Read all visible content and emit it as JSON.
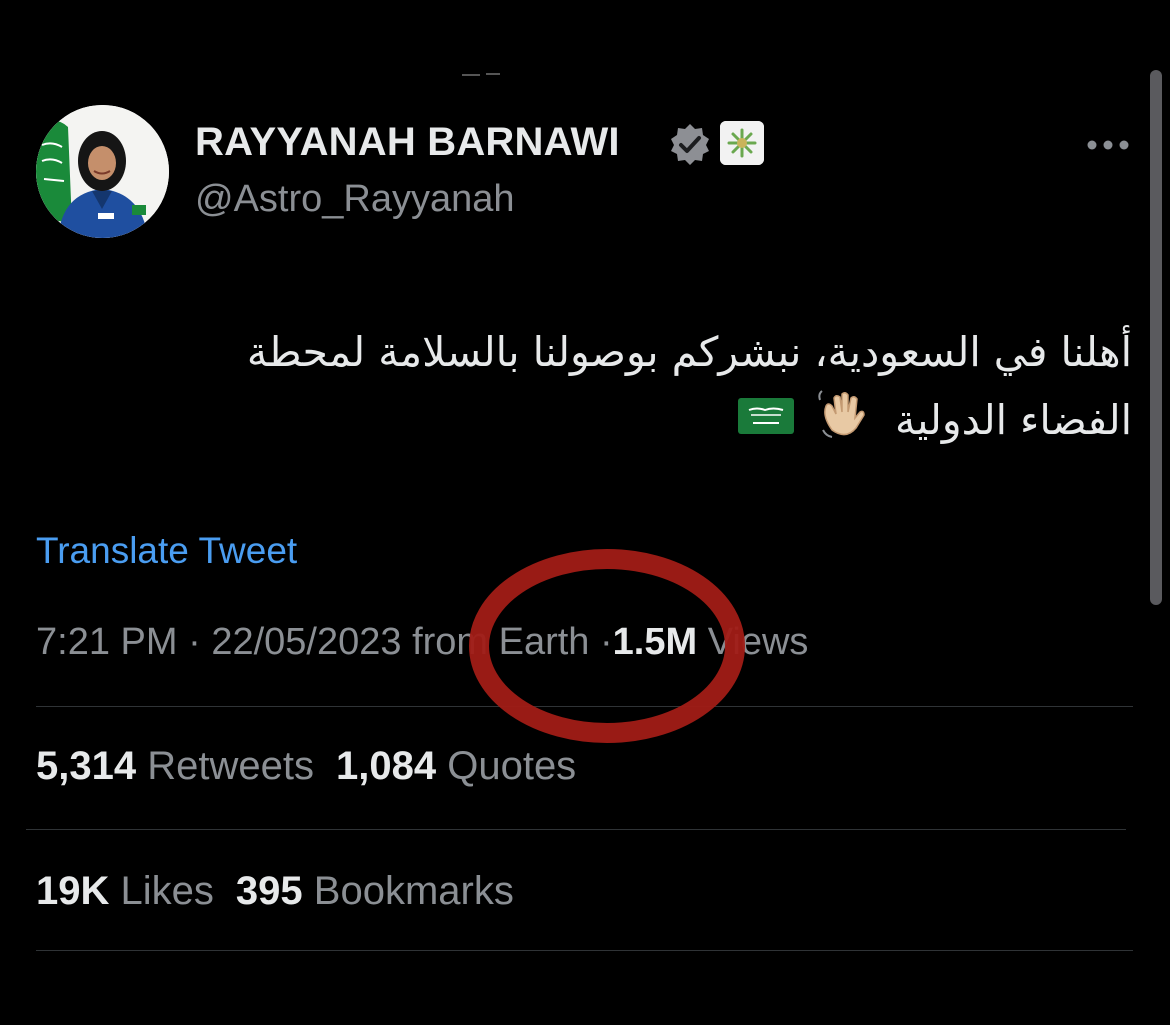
{
  "tweet": {
    "author": {
      "display_name": "RAYYANAH BARNAWI",
      "handle": "@Astro_Rayyanah"
    },
    "text_line_1": "أهلنا في السعودية، نبشركم بوصولنا بالسلامة لمحطة",
    "text_line_2": "الفضاء الدولية",
    "emojis": [
      "waving-hand-emoji",
      "saudi-flag-emoji"
    ],
    "translate_label": "Translate Tweet",
    "time": "7:21 PM",
    "separator": "·",
    "date": "22/05/2023",
    "source": "from Earth",
    "views_count": "1.5M",
    "views_label": "Views"
  },
  "stats": {
    "retweets_count": "5,314",
    "retweets_label": "Retweets",
    "quotes_count": "1,084",
    "quotes_label": "Quotes",
    "likes_count": "19K",
    "likes_label": "Likes",
    "bookmarks_count": "395",
    "bookmarks_label": "Bookmarks"
  },
  "icons": {
    "verified": "verified-badge-icon",
    "affiliate": "affiliate-badge-icon",
    "more": "more-options-icon"
  },
  "colors": {
    "background": "#000000",
    "text_primary": "#e7e9ea",
    "text_secondary": "#8b8f94",
    "link": "#4a9df1",
    "annotation": "#a11c16",
    "divider": "#2f3336"
  }
}
